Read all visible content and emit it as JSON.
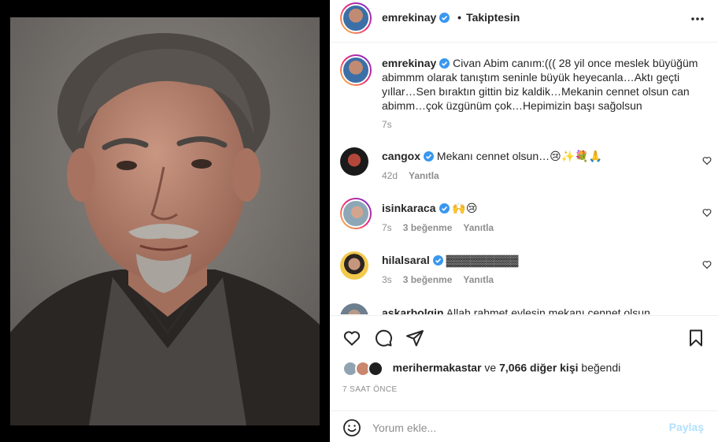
{
  "post": {
    "username": "emrekinay",
    "separator": "•",
    "follow_label": "Takiptesin",
    "caption": "Civan Abim canım:((( 28 yil once meslek büyüğüm abimmm olarak tanıştım seninle büyük heyecanla…Aktı geçti yıllar…Sen bıraktın gittin biz kaldik…Mekanin cennet olsun can abimm…çok üzgünüm çok…Hepimizin başı sağolsun",
    "caption_time": "7s"
  },
  "comments": [
    {
      "username": "cangox",
      "text": "Mekanı cennet olsun…😢✨💐🙏",
      "time": "42d",
      "likes": "",
      "reply": "Yanıtla"
    },
    {
      "username": "isinkaraca",
      "text": "🙌😢",
      "time": "7s",
      "likes": "3 beğenme",
      "reply": "Yanıtla"
    },
    {
      "username": "hilalsaral",
      "text": "▓▓▓▓▓▓▓▓▓",
      "time": "3s",
      "likes": "3 beğenme",
      "reply": "Yanıtla"
    },
    {
      "username": "askarbolgin",
      "text": "Allah rahmet eylesin mekanı cennet olsun"
    }
  ],
  "likes": {
    "first_liker": "merihermakastar",
    "connector": "ve",
    "others": "7,066 diğer kişi",
    "suffix": "beğendi"
  },
  "timestamp": "7 SAAT ÖNCE",
  "add_comment": {
    "placeholder": "Yorum ekle...",
    "share_label": "Paylaş"
  },
  "colors": {
    "verified": "#3897f0",
    "share_disabled": "#b2dffc",
    "meta_gray": "#8e8e8e"
  },
  "icons": [
    "heart-icon",
    "comment-icon",
    "share-icon",
    "bookmark-icon",
    "emoji-icon",
    "more-options-icon",
    "verified-icon"
  ]
}
